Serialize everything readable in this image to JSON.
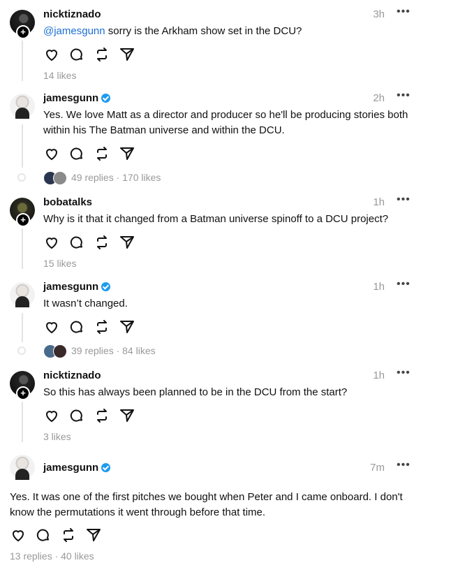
{
  "posts": [
    {
      "username": "nicktiznado",
      "verified": false,
      "time": "3h",
      "mention": "@jamesgunn",
      "text": " sorry is the Arkham show set in the DCU?",
      "meta": "14 likes"
    },
    {
      "username": "jamesgunn",
      "verified": true,
      "time": "2h",
      "text": "Yes. We love Matt as a director and producer so he'll be producing stories both within his The Batman universe and within the DCU.",
      "meta": "49 replies · 170 likes"
    },
    {
      "username": "bobatalks",
      "verified": false,
      "time": "1h",
      "text": "Why is it that it changed from a Batman universe spinoff to a DCU project?",
      "meta": "15 likes"
    },
    {
      "username": "jamesgunn",
      "verified": true,
      "time": "1h",
      "text": "It wasn’t changed.",
      "meta": "39 replies · 84 likes"
    },
    {
      "username": "nicktiznado",
      "verified": false,
      "time": "1h",
      "text": "So this has always been planned to be in the DCU from the start?",
      "meta": "3 likes"
    },
    {
      "username": "jamesgunn",
      "verified": true,
      "time": "7m",
      "text": "Yes. It was one of the first pitches we bought when Peter and I came onboard. I don't know the permutations it went through before that time.",
      "meta": "13 replies · 40 likes"
    }
  ],
  "more_label": "•••",
  "icons": [
    "heart-icon",
    "comment-icon",
    "repost-icon",
    "share-icon"
  ]
}
